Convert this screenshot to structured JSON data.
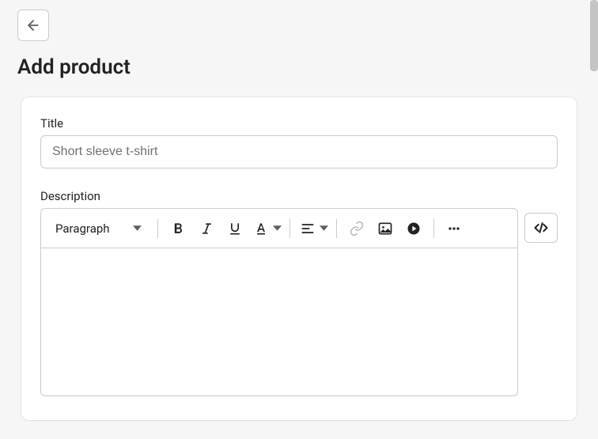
{
  "page": {
    "title": "Add product"
  },
  "form": {
    "title_label": "Title",
    "title_placeholder": "Short sleeve t-shirt",
    "title_value": "",
    "description_label": "Description"
  },
  "editor": {
    "format_select": "Paragraph",
    "body": ""
  }
}
